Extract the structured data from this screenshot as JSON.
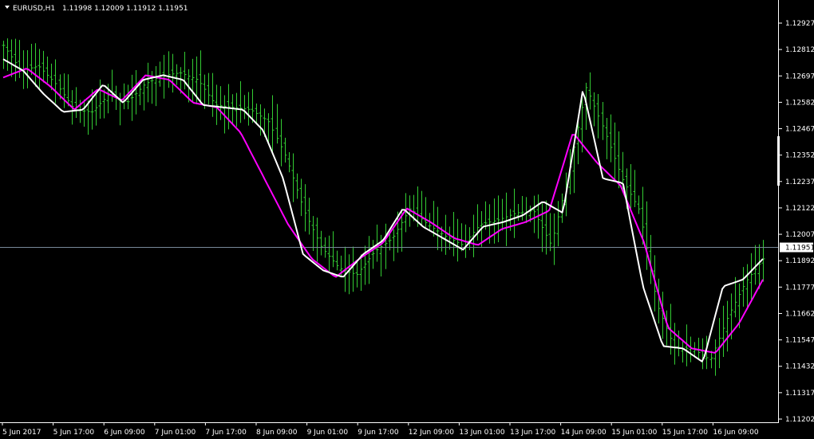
{
  "header": {
    "symbol_timeframe": "EURUSD,H1",
    "ohlc": "1.11998 1.12009 1.11912 1.11951"
  },
  "colors": {
    "background": "#000000",
    "bars": "#33cc33",
    "ma_fast": "#ffffff",
    "ma_slow": "#ff00ff",
    "axis": "#ffffff",
    "price_line": "#778899",
    "price_label_bg": "#ffffff",
    "price_label_text": "#000000"
  },
  "chart_data": {
    "type": "ohlc",
    "symbol": "EURUSD",
    "timeframe": "H1",
    "y_ticks": [
      "1.12927",
      "1.12812",
      "1.12697",
      "1.12582",
      "1.12467",
      "1.12352",
      "1.12237",
      "1.12122",
      "1.12007",
      "1.11892",
      "1.11777",
      "1.11662",
      "1.11547",
      "1.11432",
      "1.11317",
      "1.11202"
    ],
    "ylim": [
      1.11202,
      1.12975
    ],
    "x_ticks": [
      "5 Jun 2017",
      "5 Jun 17:00",
      "6 Jun 09:00",
      "7 Jun 01:00",
      "7 Jun 17:00",
      "8 Jun 09:00",
      "9 Jun 01:00",
      "9 Jun 17:00",
      "12 Jun 09:00",
      "13 Jun 01:00",
      "13 Jun 17:00",
      "14 Jun 09:00",
      "15 Jun 01:00",
      "15 Jun 17:00",
      "16 Jun 09:00"
    ],
    "current_price": "1.11951",
    "current_price_value": 1.11951,
    "close_anchors": [
      1.1283,
      1.1272,
      1.1274,
      1.1266,
      1.1255,
      1.1254,
      1.1262,
      1.1258,
      1.1266,
      1.127,
      1.1271,
      1.1268,
      1.1257,
      1.1256,
      1.1255,
      1.125,
      1.1234,
      1.1211,
      1.1195,
      1.1186,
      1.1183,
      1.1193,
      1.1199,
      1.1212,
      1.1205,
      1.12,
      1.1196,
      1.1205,
      1.1207,
      1.121,
      1.1211,
      1.1196,
      1.1227,
      1.1265,
      1.1246,
      1.1225,
      1.1211,
      1.117,
      1.1151,
      1.1151,
      1.1146,
      1.1165,
      1.118,
      1.119
    ],
    "fast_ma_anchors": [
      1.1277,
      1.1272,
      1.1262,
      1.1254,
      1.1255,
      1.1266,
      1.1258,
      1.1268,
      1.127,
      1.1268,
      1.1257,
      1.1256,
      1.1255,
      1.1246,
      1.1225,
      1.1192,
      1.1185,
      1.1182,
      1.1192,
      1.1198,
      1.1212,
      1.1204,
      1.1199,
      1.1194,
      1.1204,
      1.1206,
      1.1209,
      1.1215,
      1.121,
      1.1264,
      1.1225,
      1.1223,
      1.1178,
      1.1152,
      1.1151,
      1.1145,
      1.1178,
      1.1181,
      1.119
    ],
    "slow_ma_anchors": [
      1.1269,
      1.1273,
      1.1265,
      1.1255,
      1.1264,
      1.1259,
      1.127,
      1.1268,
      1.1258,
      1.1256,
      1.1245,
      1.1225,
      1.1205,
      1.119,
      1.1182,
      1.119,
      1.1197,
      1.1212,
      1.1206,
      1.1199,
      1.1196,
      1.1203,
      1.1206,
      1.1211,
      1.1245,
      1.1232,
      1.1222,
      1.1197,
      1.116,
      1.1151,
      1.1149,
      1.1162,
      1.1181
    ]
  }
}
